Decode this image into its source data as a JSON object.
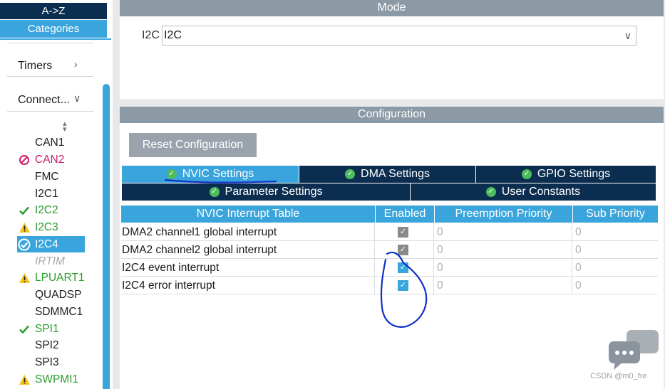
{
  "sidebar": {
    "sort_az": "A->Z",
    "sort_categories": "Categories",
    "groups": [
      {
        "label": "Timers",
        "icon": "chevron-right-icon"
      },
      {
        "label": "Connect...",
        "icon": "chevron-down-icon"
      }
    ],
    "peripherals": [
      {
        "label": "CAN1",
        "status": "none"
      },
      {
        "label": "CAN2",
        "status": "disabled"
      },
      {
        "label": "FMC",
        "status": "none"
      },
      {
        "label": "I2C1",
        "status": "none"
      },
      {
        "label": "I2C2",
        "status": "ok"
      },
      {
        "label": "I2C3",
        "status": "warning"
      },
      {
        "label": "I2C4",
        "status": "selected"
      },
      {
        "label": "IRTIM",
        "status": "unavailable"
      },
      {
        "label": "LPUART1",
        "status": "warning"
      },
      {
        "label": "QUADSP",
        "status": "none"
      },
      {
        "label": "SDMMC1",
        "status": "none"
      },
      {
        "label": "SPI1",
        "status": "ok"
      },
      {
        "label": "SPI2",
        "status": "none"
      },
      {
        "label": "SPI3",
        "status": "none"
      },
      {
        "label": "SWPMI1",
        "status": "warning"
      }
    ]
  },
  "mode": {
    "title": "Mode",
    "field_label": "I2C",
    "field_value": "I2C"
  },
  "configuration": {
    "title": "Configuration",
    "reset_label": "Reset Configuration",
    "tabs": [
      {
        "label": "NVIC Settings",
        "active": true
      },
      {
        "label": "DMA Settings",
        "active": false
      },
      {
        "label": "GPIO Settings",
        "active": false
      },
      {
        "label": "Parameter Settings",
        "active": false
      },
      {
        "label": "User Constants",
        "active": false
      }
    ],
    "table": {
      "headers": [
        "NVIC Interrupt Table",
        "Enabled",
        "Preemption Priority",
        "Sub Priority"
      ],
      "rows": [
        {
          "name": "DMA2 channel1 global interrupt",
          "enabled": true,
          "locked": true,
          "preemption": "0",
          "sub": "0"
        },
        {
          "name": "DMA2 channel2 global interrupt",
          "enabled": true,
          "locked": true,
          "preemption": "0",
          "sub": "0"
        },
        {
          "name": "I2C4 event interrupt",
          "enabled": true,
          "locked": false,
          "preemption": "0",
          "sub": "0"
        },
        {
          "name": "I2C4 error interrupt",
          "enabled": true,
          "locked": false,
          "preemption": "0",
          "sub": "0"
        }
      ]
    }
  },
  "watermark": "CSDN @m0_fre",
  "colors": {
    "navy": "#0b2d4f",
    "accent": "#3aa5dc",
    "ok": "#2a9d2f",
    "warning": "#f2c318",
    "disabled": "#cc1f6a",
    "ink": "#1030c8"
  }
}
